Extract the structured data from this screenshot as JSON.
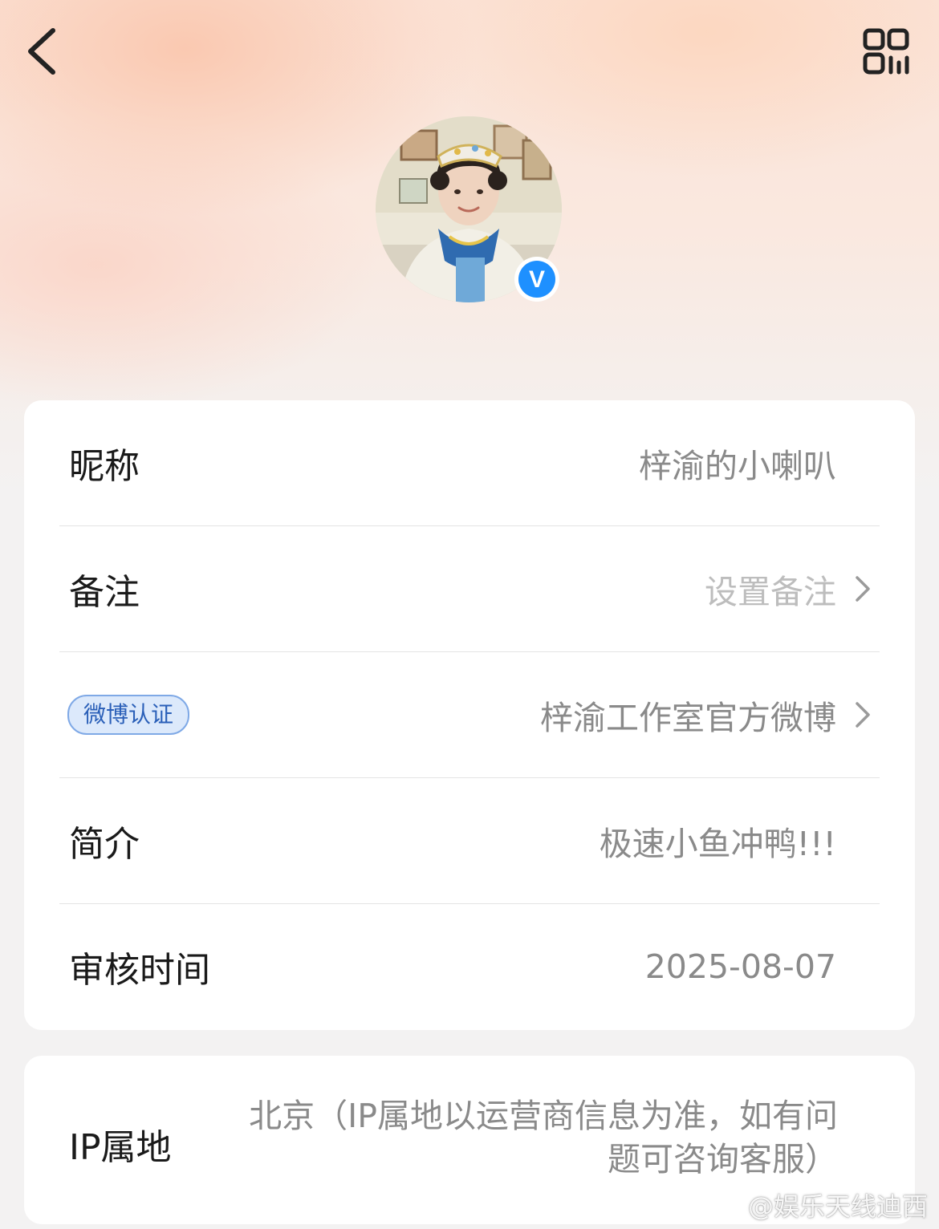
{
  "header": {
    "back_icon": "chevron-left-icon",
    "qr_icon": "qr-code-icon"
  },
  "profile": {
    "verified_badge_letter": "V",
    "verified_color": "#1e90ff"
  },
  "rows": [
    {
      "label": "昵称",
      "value": "梓渝的小喇叭"
    },
    {
      "label": "备注",
      "value": "设置备注"
    },
    {
      "badge": "微博认证",
      "value": "梓渝工作室官方微博"
    },
    {
      "label": "简介",
      "value": "极速小鱼冲鸭!!!"
    },
    {
      "label": "审核时间",
      "value": "2025-08-07"
    }
  ],
  "ip": {
    "label": "IP属地",
    "value": "北京（IP属地以运营商信息为准，如有问题可咨询客服）"
  },
  "watermark": {
    "text": "@娱乐天线迪西"
  },
  "colors": {
    "badge_bg": "#dce9fb",
    "badge_border": "#7fa9e6",
    "badge_text": "#2a5fb8"
  }
}
